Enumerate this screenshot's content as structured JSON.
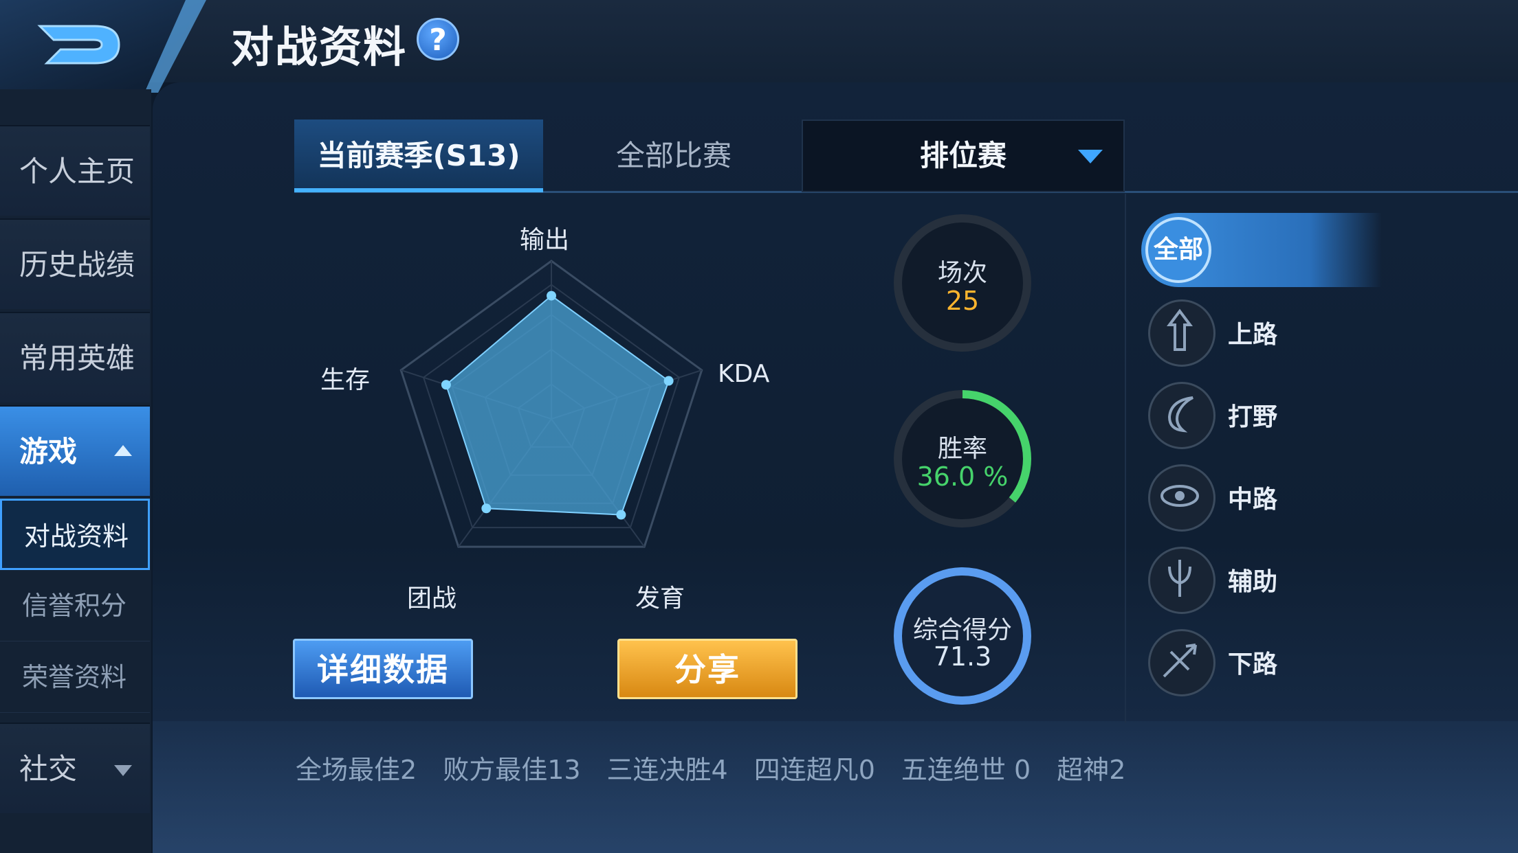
{
  "header": {
    "title": "对战资料",
    "help": "?"
  },
  "sidebar": {
    "items": [
      {
        "label": "个人主页"
      },
      {
        "label": "历史战绩"
      },
      {
        "label": "常用英雄"
      },
      {
        "label": "游戏",
        "expanded": true
      },
      {
        "label": "社交"
      }
    ],
    "sub_items": [
      {
        "label": "对战资料",
        "active": true
      },
      {
        "label": "信誉积分"
      },
      {
        "label": "荣誉资料"
      }
    ]
  },
  "tabs": [
    {
      "label": "当前赛季(S13)",
      "active": true
    },
    {
      "label": "全部比赛"
    }
  ],
  "mode_select": {
    "value": "排位赛"
  },
  "radar": {
    "axes": [
      "输出",
      "KDA",
      "发育",
      "团战",
      "生存"
    ],
    "values": [
      0.78,
      0.78,
      0.75,
      0.7,
      0.7
    ]
  },
  "buttons": {
    "detail": "详细数据",
    "share": "分享"
  },
  "stats": {
    "matches": {
      "label": "场次",
      "value": "25"
    },
    "win_rate": {
      "label": "胜率",
      "value": "36.0 %",
      "fraction": 0.36
    },
    "score": {
      "label": "综合得分",
      "value": "71.3"
    }
  },
  "roles": {
    "all": "全部",
    "items": [
      {
        "label": "上路",
        "icon": "top-lane-icon"
      },
      {
        "label": "打野",
        "icon": "jungle-icon"
      },
      {
        "label": "中路",
        "icon": "mid-lane-icon"
      },
      {
        "label": "辅助",
        "icon": "support-icon"
      },
      {
        "label": "下路",
        "icon": "bottom-lane-icon"
      }
    ]
  },
  "bottom_stats": [
    "全场最佳2",
    "败方最佳13",
    "三连决胜4",
    "四连超凡0",
    "五连绝世 0",
    "超神2"
  ],
  "colors": {
    "accent": "#3fa6ff",
    "win_rate": "#46d36b",
    "matches": "#ffb52e",
    "share": "#f0a020"
  }
}
